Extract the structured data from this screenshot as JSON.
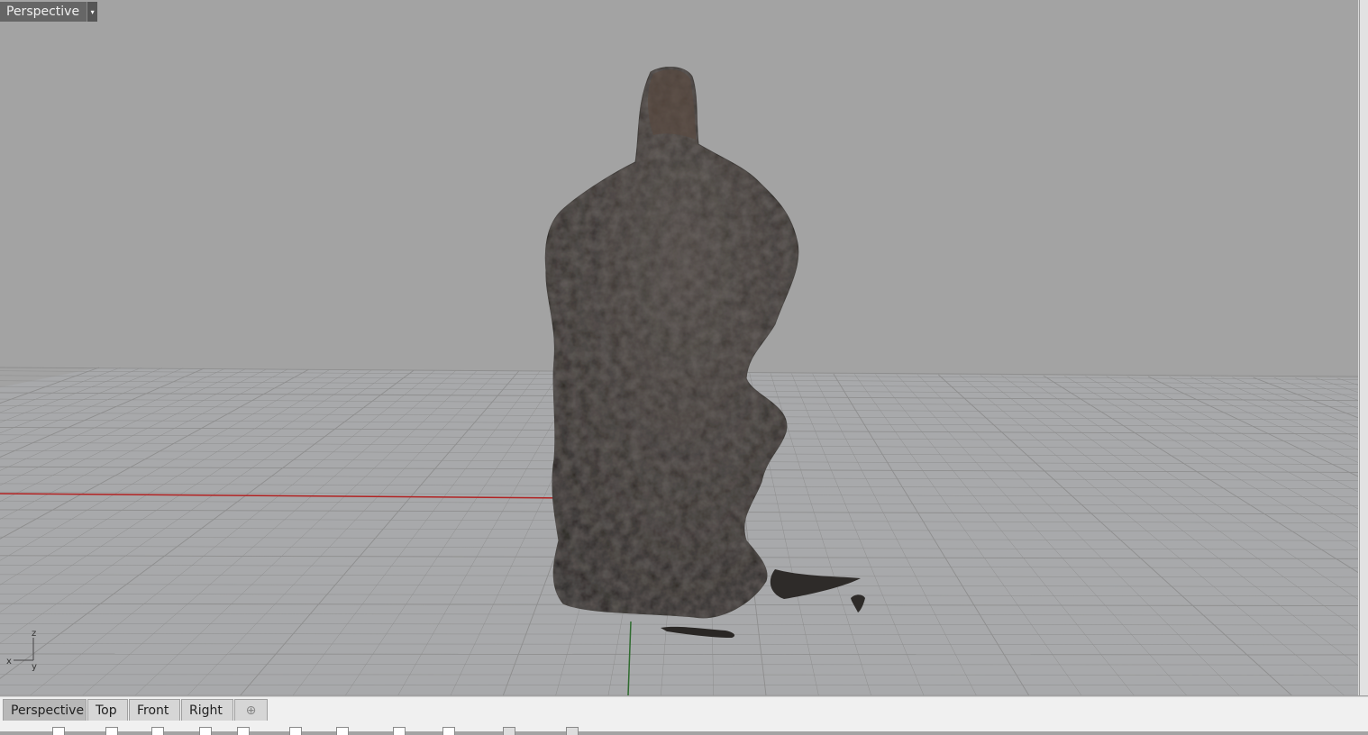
{
  "viewport": {
    "title": "Perspective",
    "menu_glyph": "▾"
  },
  "axis_labels": {
    "z": "z",
    "x": "x",
    "y": "y"
  },
  "tabs": [
    {
      "label": "Perspective",
      "active": true
    },
    {
      "label": "Top",
      "active": false
    },
    {
      "label": "Front",
      "active": false
    },
    {
      "label": "Right",
      "active": false
    }
  ],
  "add_tab_glyph": "⊕",
  "colors": {
    "viewport_bg": "#a3a3a3",
    "grid_line": "#8e8e8e",
    "x_axis": "#b22222",
    "y_axis": "#2f6b2f",
    "object": "#3a3531"
  }
}
